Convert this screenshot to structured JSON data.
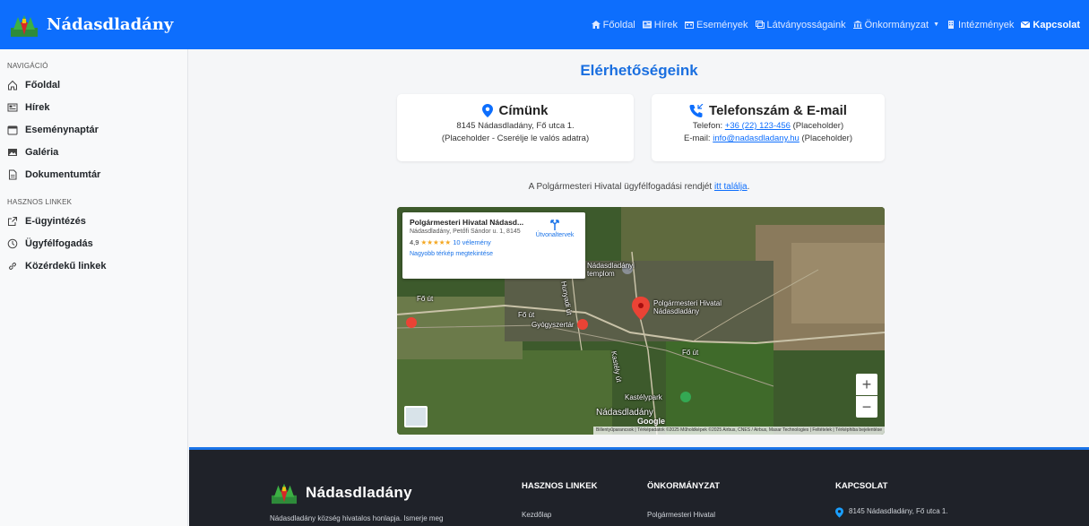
{
  "brand": {
    "name": "Nádasdladány"
  },
  "nav": [
    {
      "label": "Főoldal",
      "icon": "home-icon"
    },
    {
      "label": "Hírek",
      "icon": "newspaper-icon"
    },
    {
      "label": "Események",
      "icon": "calendar-icon"
    },
    {
      "label": "Látványosságaink",
      "icon": "images-icon"
    },
    {
      "label": "Önkormányzat",
      "icon": "bank-icon",
      "dropdown": true
    },
    {
      "label": "Intézmények",
      "icon": "building-icon"
    },
    {
      "label": "Kapcsolat",
      "icon": "envelope-icon",
      "active": true
    }
  ],
  "sidebar": {
    "heading_nav": "Navigáció",
    "nav_items": [
      {
        "label": "Főoldal",
        "icon": "house-icon"
      },
      {
        "label": "Hírek",
        "icon": "newspaper-icon"
      },
      {
        "label": "Eseménynaptár",
        "icon": "calendar-icon"
      },
      {
        "label": "Galéria",
        "icon": "image-icon"
      },
      {
        "label": "Dokumentumtár",
        "icon": "file-icon"
      }
    ],
    "heading_links": "Hasznos linkek",
    "link_items": [
      {
        "label": "E-ügyintézés",
        "icon": "external-link-icon"
      },
      {
        "label": "Ügyfélfogadás",
        "icon": "clock-icon"
      },
      {
        "label": "Közérdekű linkek",
        "icon": "link-icon"
      }
    ]
  },
  "main": {
    "title": "Elérhetőségeink",
    "address_card": {
      "title": "Címünk",
      "line1": "8145 Nádasdladány, Fő utca 1.",
      "line2": "(Placeholder - Cserélje le valós adatra)"
    },
    "phone_card": {
      "title": "Telefonszám & E-mail",
      "phone_prefix": "Telefon: ",
      "phone": "+36 (22) 123-456",
      "phone_suffix": " (Placeholder)",
      "email_prefix": "E-mail: ",
      "email": "info@nadasdladany.hu",
      "email_suffix": " (Placeholder)"
    },
    "hours_note": {
      "prefix": "A Polgármesteri Hivatal ügyfélfogadási rendjét ",
      "link": "itt találja",
      "suffix": "."
    }
  },
  "map": {
    "place_name": "Polgármesteri Hivatal Nádasd...",
    "place_address": "Nádasdladány, Petőfi Sándor u. 1, 8145",
    "rating": "4,9",
    "stars": "★★★★★",
    "reviews": "10 vélemény",
    "bigger_map": "Nagyobb térkép megtekintése",
    "route": "Útvonaltervek",
    "labels": {
      "church": "Nádasdladányi\ntemplom",
      "marker": "Polgármesteri Hivatal\nNádasdladány",
      "pharmacy": "Gyógyszertár",
      "park": "Kastélypark",
      "town": "Nádasdladány",
      "fo_ut": "Fő út",
      "hunyadi": "Hunyadi út",
      "kastely": "Kastély út"
    },
    "google": "Google",
    "zoom_in": "+",
    "zoom_out": "−",
    "attribution": "Billentyűparancsok | Térképadatok ©2025 Műholdképek ©2025 Airbus, CNES / Airbus, Maxar Technologies | Feltételek | Térképhiba bejelentése"
  },
  "footer": {
    "brand": "Nádasdladány",
    "description": "Nádasdladány község hivatalos honlapja. Ismerje meg",
    "col_links_title": "Hasznos linkek",
    "col_links_first": "Kezdőlap",
    "col_gov_title": "Önkormányzat",
    "col_gov_first": "Polgármesteri Hivatal",
    "col_contact_title": "Kapcsolat",
    "col_contact_address": "8145 Nádasdladány, Fő utca 1."
  },
  "colors": {
    "primary": "#0d6efd",
    "title_blue": "#1a6fe0",
    "footer_bg": "#1f2229",
    "marker_red": "#ea4335"
  }
}
